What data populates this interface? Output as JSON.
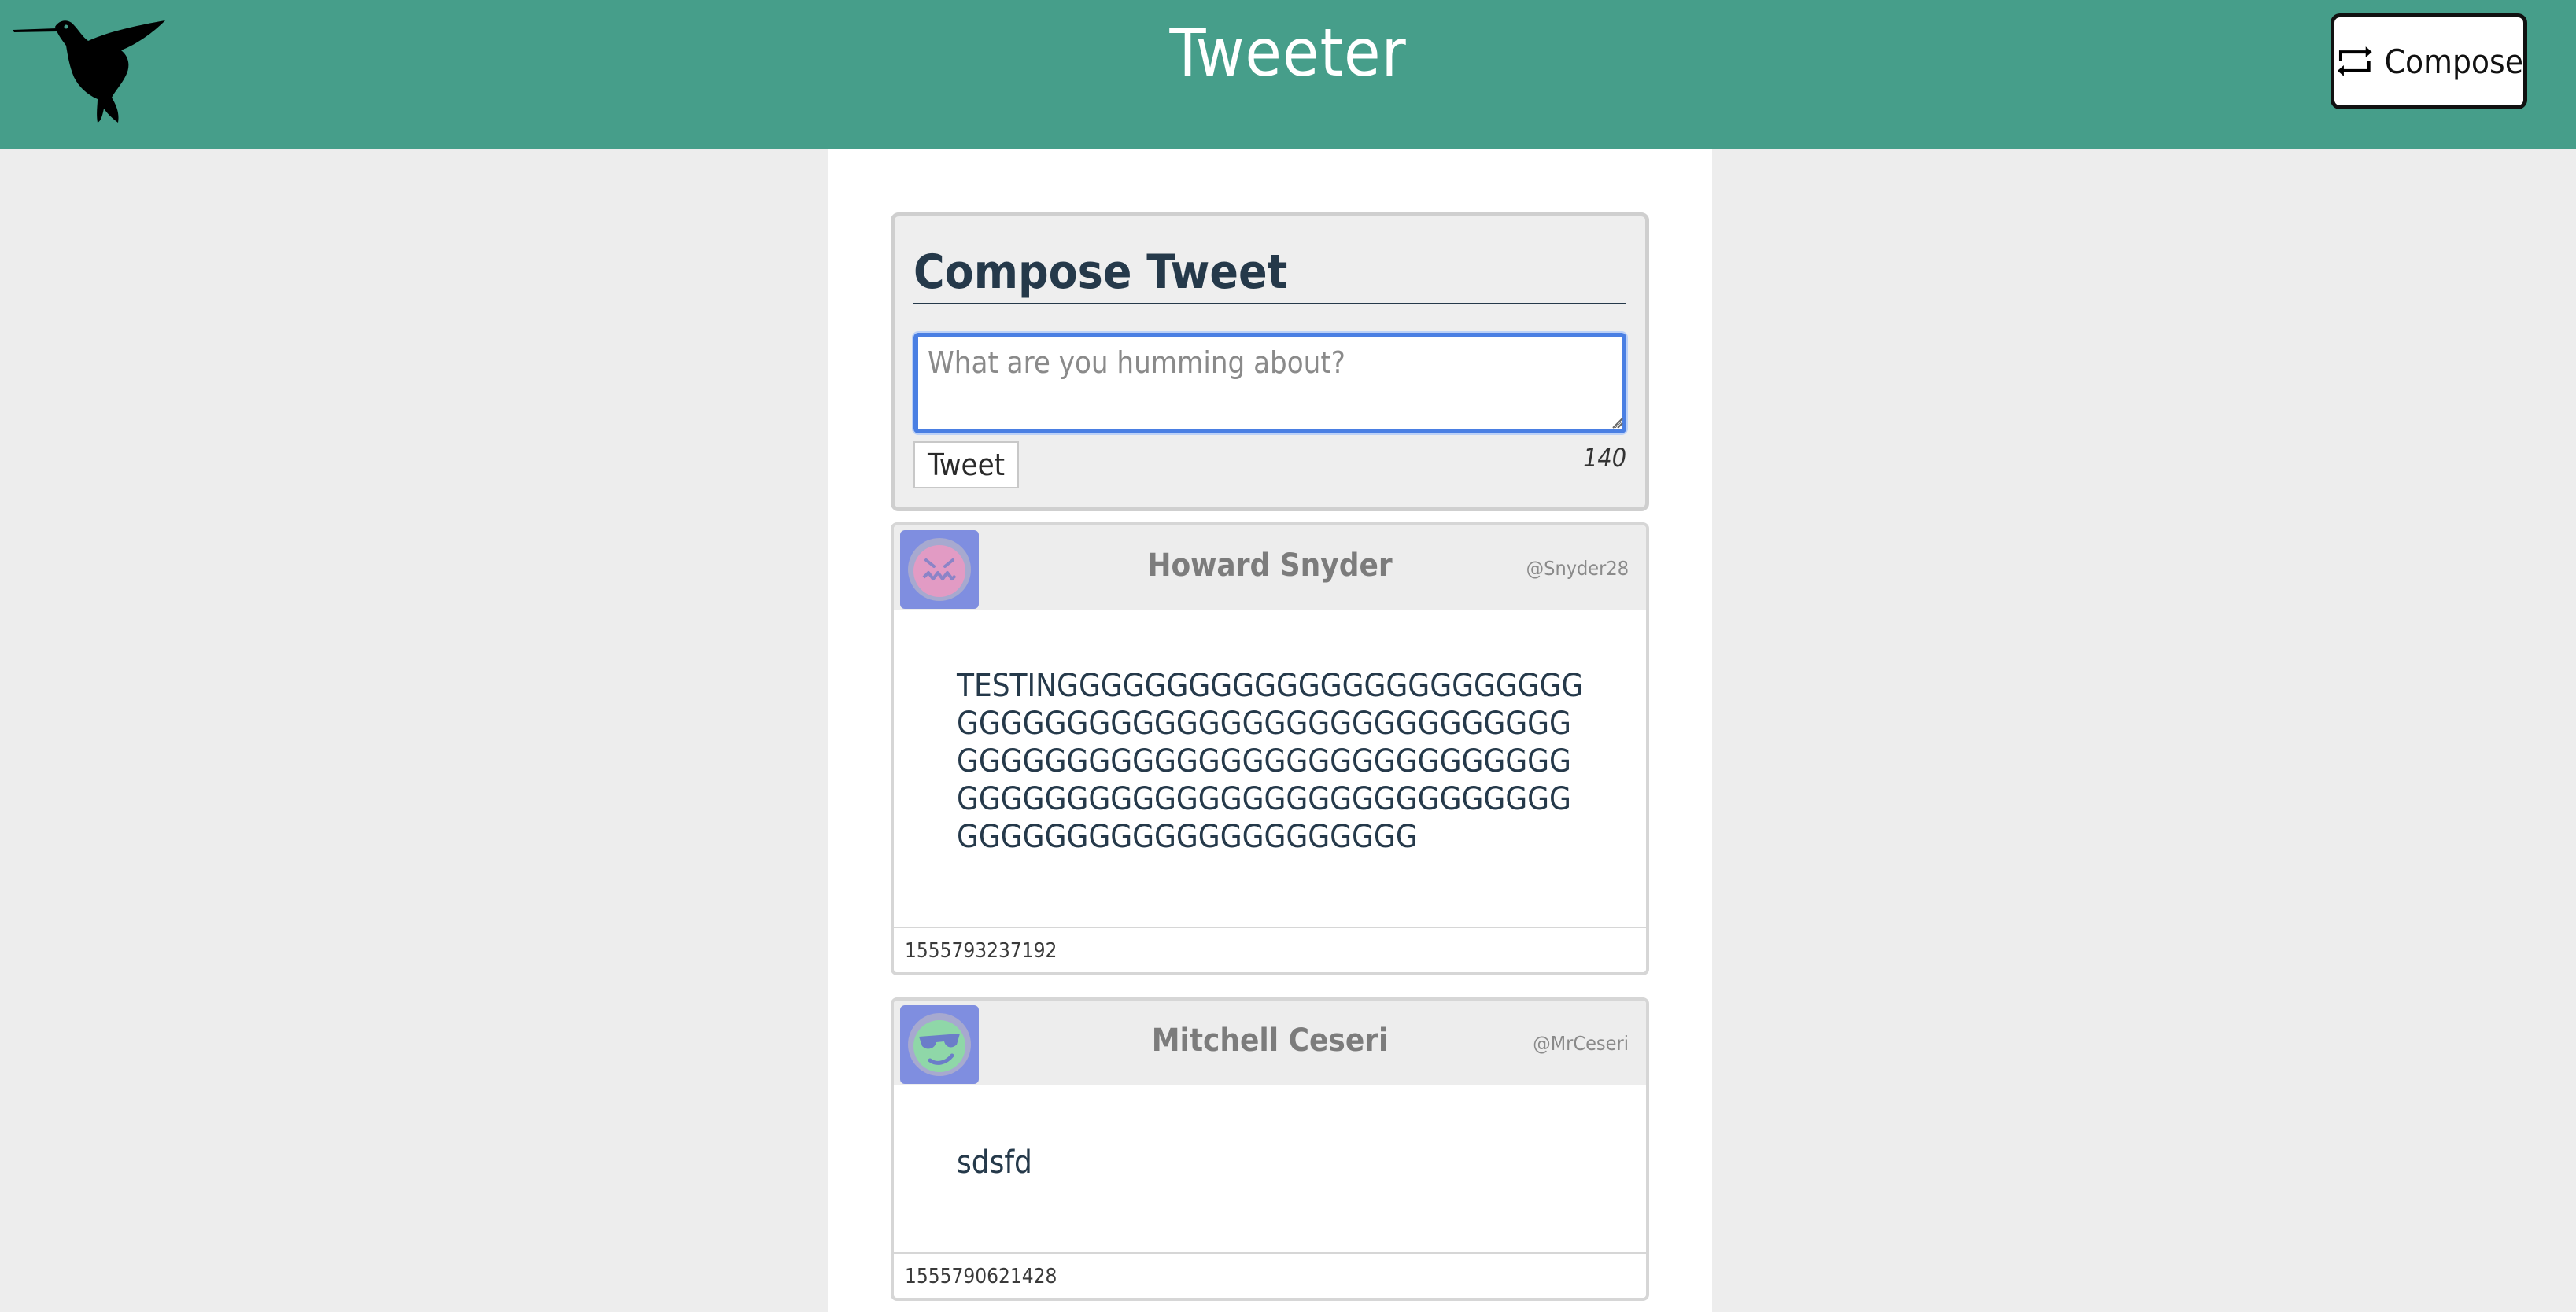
{
  "header": {
    "title": "Tweeter",
    "compose_label": "Compose",
    "logo_icon": "hummingbird-logo",
    "compose_icon": "swap-arrows-icon",
    "background_color": "#469e8a"
  },
  "composer": {
    "heading": "Compose Tweet",
    "placeholder": "What are you humming about?",
    "submit_label": "Tweet",
    "char_counter": "140"
  },
  "tweets": [
    {
      "name": "Howard Snyder",
      "handle": "@Snyder28",
      "content": "TESTINGGGGGGGGGGGGGGGGGGGGGGGGGGGGGGGGGGGGGGGGGGGGGGGGGGGGGGGGGGGGGGGGGGGGGGGGGGGGGGGGGGGGGGGGGGGGGGGGGGGGGGGGGGGGGGGGGGGGGGGGGGGGGGGGG",
      "timestamp": "1555793237192",
      "avatar_icon": "grimace-face-avatar"
    },
    {
      "name": "Mitchell Ceseri",
      "handle": "@MrCeseri",
      "content": "sdsfd",
      "timestamp": "1555790621428",
      "avatar_icon": "sunglasses-face-avatar"
    }
  ]
}
